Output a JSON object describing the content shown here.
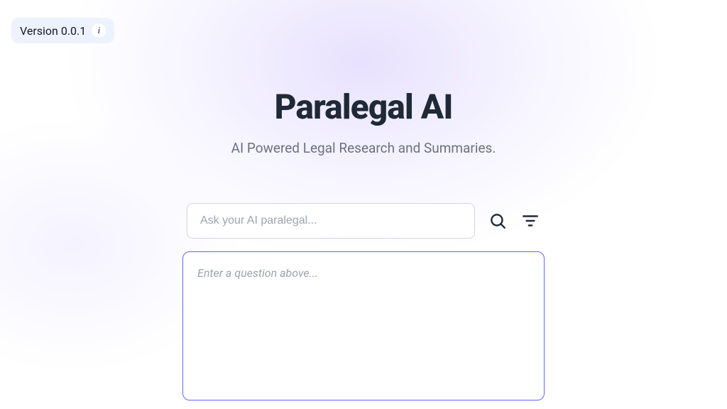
{
  "version": {
    "label": "Version 0.0.1",
    "info_char": "i"
  },
  "header": {
    "title": "Paralegal AI",
    "subtitle": "AI Powered Legal Research and Summaries."
  },
  "search": {
    "placeholder": "Ask your AI paralegal...",
    "value": ""
  },
  "results": {
    "placeholder": "Enter a question above..."
  }
}
